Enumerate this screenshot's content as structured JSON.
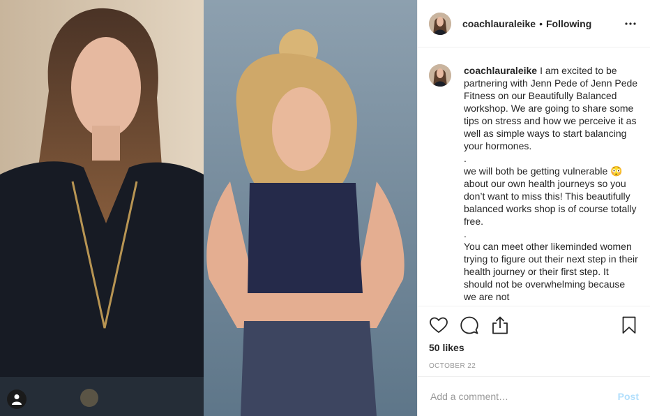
{
  "post": {
    "header": {
      "username": "coachlauraleike",
      "separator": "•",
      "follow_status": "Following"
    },
    "caption": {
      "username": "coachlauraleike",
      "text": "I am excited to be partnering with Jenn Pede of Jenn Pede Fitness on our Beautifully Balanced workshop. We are going to share some tips on stress and how we perceive it as well as simple ways to start balancing your hormones.\n.\nwe will both be getting vulnerable 😳 about our own health journeys so you don’t want to miss this! This beautifully balanced works shop is of course totally free.\n.\nYou can meet other likeminded women trying to figure out their next step in their health journey or their first step. It should not be overwhelming because we are not"
    },
    "likes": "50 likes",
    "date": "OCTOBER 22",
    "comment_input": {
      "placeholder": "Add a comment…",
      "value": ""
    },
    "post_button": "Post",
    "icons": {
      "more": "more-options-icon",
      "like": "heart-icon",
      "comment": "comment-bubble-icon",
      "share": "share-icon",
      "save": "bookmark-icon",
      "tag": "user-tag-icon"
    },
    "colors": {
      "text": "#262626",
      "muted": "#999999",
      "border": "#efefef",
      "post_button": "#b2dffc"
    }
  }
}
